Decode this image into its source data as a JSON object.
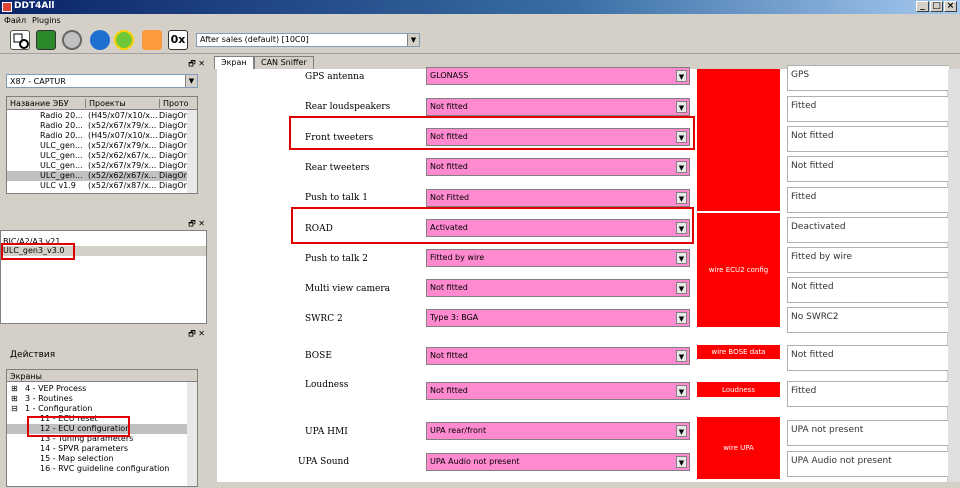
{
  "window": {
    "title": "DDT4All"
  },
  "menu": {
    "file": "Файл",
    "plugins": "Plugins"
  },
  "toolbar": {
    "icons": [
      "scan-icon",
      "ecu-icon",
      "settings-icon",
      "refresh-icon",
      "connect-icon",
      "heart-icon",
      "hex-icon"
    ],
    "hex_label": "0x",
    "session_select": "After sales (default) [10C0]"
  },
  "left": {
    "vehicle_select": "X87 - CAPTUR",
    "ecu_table": {
      "headers": [
        "Название ЭБУ",
        "Проекты",
        "Прото"
      ],
      "rows": [
        [
          "Radio 20...",
          "(H45/x07/x10/x...",
          "DiagOn"
        ],
        [
          "Radio 20...",
          "(x52/x67/x79/x...",
          "DiagOn"
        ],
        [
          "Radio 20...",
          "(H45/x07/x10/x...",
          "DiagOn"
        ],
        [
          "ULC_gen...",
          "(x52/x67/x79/x...",
          "DiagOn"
        ],
        [
          "ULC_gen...",
          "(x52/x62/x67/x...",
          "DiagOn"
        ],
        [
          "ULC_gen...",
          "(x52/x67/x79/x...",
          "DiagOn"
        ],
        [
          "ULC_gen...",
          "(x52/x62/x67/x...",
          "DiagOn"
        ],
        [
          "ULC v1.9",
          "(x52/x67/x87/x...",
          "DiagOn"
        ]
      ],
      "selected_row": 6
    },
    "ecu_list": [
      "BIC/A2/A3 v21",
      "ULC_gen3_v3.0"
    ],
    "actions_title": "Действия",
    "screens_header": "Экраны",
    "screens": [
      {
        "exp": "⊞",
        "label": "4 - VEP Process",
        "indent": 0
      },
      {
        "exp": "⊞",
        "label": "3 - Routines",
        "indent": 0
      },
      {
        "exp": "⊟",
        "label": "1 - Configuration",
        "indent": 0
      },
      {
        "exp": "",
        "label": "11 - ECU reset",
        "indent": 1
      },
      {
        "exp": "",
        "label": "12 - ECU configuration",
        "indent": 1
      },
      {
        "exp": "",
        "label": "13 - Tuning parameters",
        "indent": 1
      },
      {
        "exp": "",
        "label": "14 - SPVR parameters",
        "indent": 1
      },
      {
        "exp": "",
        "label": "15 - Map selection",
        "indent": 1
      },
      {
        "exp": "",
        "label": "16 - RVC guideline configuration",
        "indent": 1
      }
    ],
    "screens_selected": 4
  },
  "tabs": [
    "Экран",
    "CAN Sniffer"
  ],
  "params": [
    {
      "label": "GPS antenna",
      "value": "GLONASS",
      "current": "GPS"
    },
    {
      "label": "Rear loudspeakers",
      "value": "Not fitted",
      "current": "Fitted"
    },
    {
      "label": "Front tweeters",
      "value": "Not fitted",
      "current": "Not fitted"
    },
    {
      "label": "Rear tweeters",
      "value": "Not fitted",
      "current": "Not fitted"
    },
    {
      "label": "Push to talk 1",
      "value": "Not Fitted",
      "current": "Fitted"
    },
    {
      "label": "ROAD",
      "value": "Activated",
      "current": "Deactivated"
    },
    {
      "label": "Push to talk 2",
      "value": "Fitted by wire",
      "current": "Fitted by wire"
    },
    {
      "label": "Multi view camera",
      "value": "Not fitted",
      "current": "Not fitted"
    },
    {
      "label": "SWRC 2",
      "value": "Type 3: BGA",
      "current": "No SWRC2"
    },
    {
      "label": "BOSE",
      "value": "Not fitted",
      "current": "Not fitted"
    },
    {
      "label": "Loudness",
      "value": "Not fitted",
      "current": "Fitted"
    },
    {
      "label": "UPA HMI",
      "value": "UPA rear/front",
      "current": "UPA not present"
    },
    {
      "label": "UPA Sound",
      "value": "UPA Audio not present",
      "current": "UPA Audio not present"
    }
  ],
  "red_blocks": {
    "wire_ecu2": "wire ECU2 config",
    "wire_bose": "wire BOSE data",
    "loudness": "Loudness",
    "wire_upa": "wire UPA"
  },
  "colors": {
    "combo": "#ff8ad0",
    "red": "#ff0000",
    "highlight": "#e00000"
  }
}
